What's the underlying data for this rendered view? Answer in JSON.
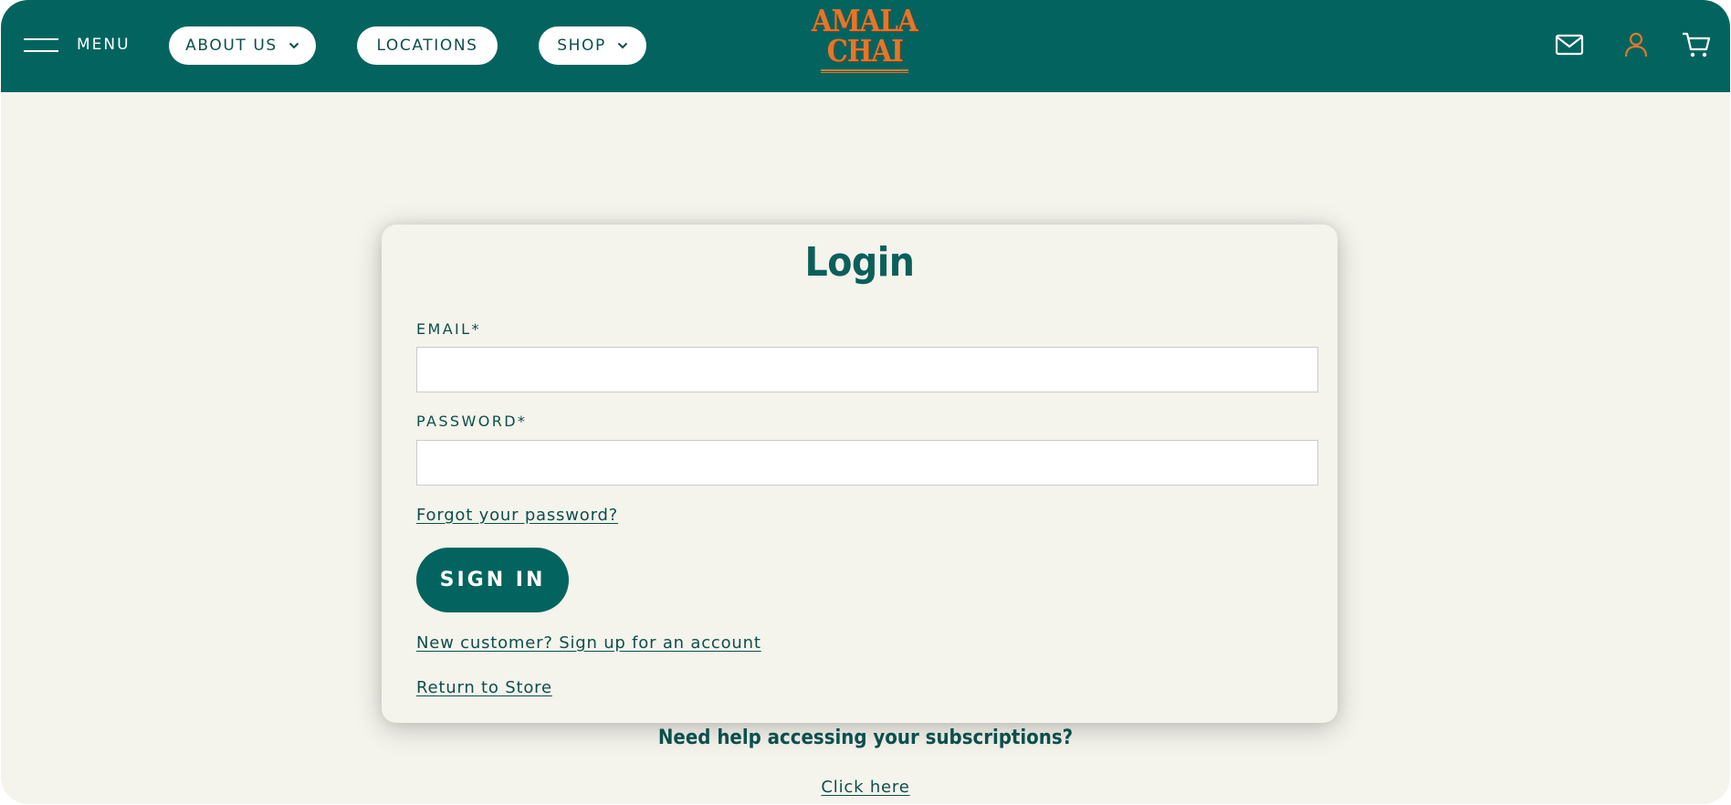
{
  "header": {
    "menu_label": "MENU",
    "nav": [
      {
        "label": "ABOUT US",
        "has_dropdown": true
      },
      {
        "label": "LOCATIONS",
        "has_dropdown": false
      },
      {
        "label": "SHOP",
        "has_dropdown": true
      }
    ],
    "logo": {
      "line1": "AMALA",
      "line2": "CHAI"
    },
    "icons": [
      "mail-icon",
      "account-icon",
      "cart-icon"
    ]
  },
  "login": {
    "title": "Login",
    "email_label": "EMAIL*",
    "email_value": "",
    "password_label": "PASSWORD*",
    "password_value": "",
    "forgot_link": "Forgot your password?",
    "submit_label": "SIGN IN",
    "signup_link": "New customer? Sign up for an account",
    "return_link": "Return to Store"
  },
  "help": {
    "heading": "Need help accessing your subscriptions?",
    "link": "Click here"
  },
  "colors": {
    "brand_teal": "#03645f",
    "accent_orange": "#e2772c",
    "background": "#f4f3ec"
  }
}
